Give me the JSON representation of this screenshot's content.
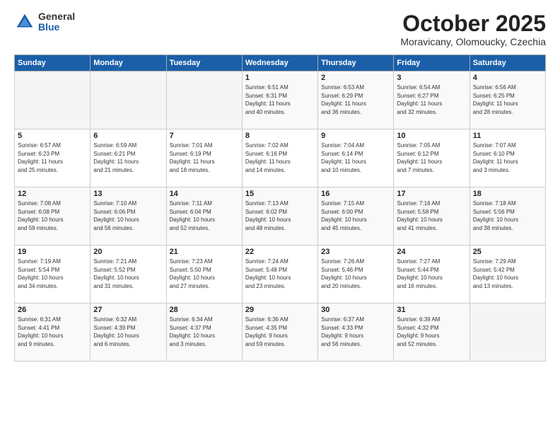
{
  "header": {
    "logo_general": "General",
    "logo_blue": "Blue",
    "month_title": "October 2025",
    "location": "Moravicany, Olomoucky, Czechia"
  },
  "days_of_week": [
    "Sunday",
    "Monday",
    "Tuesday",
    "Wednesday",
    "Thursday",
    "Friday",
    "Saturday"
  ],
  "weeks": [
    [
      {
        "day": "",
        "info": ""
      },
      {
        "day": "",
        "info": ""
      },
      {
        "day": "",
        "info": ""
      },
      {
        "day": "1",
        "info": "Sunrise: 6:51 AM\nSunset: 6:31 PM\nDaylight: 11 hours\nand 40 minutes."
      },
      {
        "day": "2",
        "info": "Sunrise: 6:53 AM\nSunset: 6:29 PM\nDaylight: 11 hours\nand 36 minutes."
      },
      {
        "day": "3",
        "info": "Sunrise: 6:54 AM\nSunset: 6:27 PM\nDaylight: 11 hours\nand 32 minutes."
      },
      {
        "day": "4",
        "info": "Sunrise: 6:56 AM\nSunset: 6:25 PM\nDaylight: 11 hours\nand 28 minutes."
      }
    ],
    [
      {
        "day": "5",
        "info": "Sunrise: 6:57 AM\nSunset: 6:23 PM\nDaylight: 11 hours\nand 25 minutes."
      },
      {
        "day": "6",
        "info": "Sunrise: 6:59 AM\nSunset: 6:21 PM\nDaylight: 11 hours\nand 21 minutes."
      },
      {
        "day": "7",
        "info": "Sunrise: 7:01 AM\nSunset: 6:19 PM\nDaylight: 11 hours\nand 18 minutes."
      },
      {
        "day": "8",
        "info": "Sunrise: 7:02 AM\nSunset: 6:16 PM\nDaylight: 11 hours\nand 14 minutes."
      },
      {
        "day": "9",
        "info": "Sunrise: 7:04 AM\nSunset: 6:14 PM\nDaylight: 11 hours\nand 10 minutes."
      },
      {
        "day": "10",
        "info": "Sunrise: 7:05 AM\nSunset: 6:12 PM\nDaylight: 11 hours\nand 7 minutes."
      },
      {
        "day": "11",
        "info": "Sunrise: 7:07 AM\nSunset: 6:10 PM\nDaylight: 11 hours\nand 3 minutes."
      }
    ],
    [
      {
        "day": "12",
        "info": "Sunrise: 7:08 AM\nSunset: 6:08 PM\nDaylight: 10 hours\nand 59 minutes."
      },
      {
        "day": "13",
        "info": "Sunrise: 7:10 AM\nSunset: 6:06 PM\nDaylight: 10 hours\nand 56 minutes."
      },
      {
        "day": "14",
        "info": "Sunrise: 7:11 AM\nSunset: 6:04 PM\nDaylight: 10 hours\nand 52 minutes."
      },
      {
        "day": "15",
        "info": "Sunrise: 7:13 AM\nSunset: 6:02 PM\nDaylight: 10 hours\nand 48 minutes."
      },
      {
        "day": "16",
        "info": "Sunrise: 7:15 AM\nSunset: 6:00 PM\nDaylight: 10 hours\nand 45 minutes."
      },
      {
        "day": "17",
        "info": "Sunrise: 7:16 AM\nSunset: 5:58 PM\nDaylight: 10 hours\nand 41 minutes."
      },
      {
        "day": "18",
        "info": "Sunrise: 7:18 AM\nSunset: 5:56 PM\nDaylight: 10 hours\nand 38 minutes."
      }
    ],
    [
      {
        "day": "19",
        "info": "Sunrise: 7:19 AM\nSunset: 5:54 PM\nDaylight: 10 hours\nand 34 minutes."
      },
      {
        "day": "20",
        "info": "Sunrise: 7:21 AM\nSunset: 5:52 PM\nDaylight: 10 hours\nand 31 minutes."
      },
      {
        "day": "21",
        "info": "Sunrise: 7:23 AM\nSunset: 5:50 PM\nDaylight: 10 hours\nand 27 minutes."
      },
      {
        "day": "22",
        "info": "Sunrise: 7:24 AM\nSunset: 5:48 PM\nDaylight: 10 hours\nand 23 minutes."
      },
      {
        "day": "23",
        "info": "Sunrise: 7:26 AM\nSunset: 5:46 PM\nDaylight: 10 hours\nand 20 minutes."
      },
      {
        "day": "24",
        "info": "Sunrise: 7:27 AM\nSunset: 5:44 PM\nDaylight: 10 hours\nand 16 minutes."
      },
      {
        "day": "25",
        "info": "Sunrise: 7:29 AM\nSunset: 5:42 PM\nDaylight: 10 hours\nand 13 minutes."
      }
    ],
    [
      {
        "day": "26",
        "info": "Sunrise: 6:31 AM\nSunset: 4:41 PM\nDaylight: 10 hours\nand 9 minutes."
      },
      {
        "day": "27",
        "info": "Sunrise: 6:32 AM\nSunset: 4:39 PM\nDaylight: 10 hours\nand 6 minutes."
      },
      {
        "day": "28",
        "info": "Sunrise: 6:34 AM\nSunset: 4:37 PM\nDaylight: 10 hours\nand 3 minutes."
      },
      {
        "day": "29",
        "info": "Sunrise: 6:36 AM\nSunset: 4:35 PM\nDaylight: 9 hours\nand 59 minutes."
      },
      {
        "day": "30",
        "info": "Sunrise: 6:37 AM\nSunset: 4:33 PM\nDaylight: 9 hours\nand 56 minutes."
      },
      {
        "day": "31",
        "info": "Sunrise: 6:39 AM\nSunset: 4:32 PM\nDaylight: 9 hours\nand 52 minutes."
      },
      {
        "day": "",
        "info": ""
      }
    ]
  ]
}
